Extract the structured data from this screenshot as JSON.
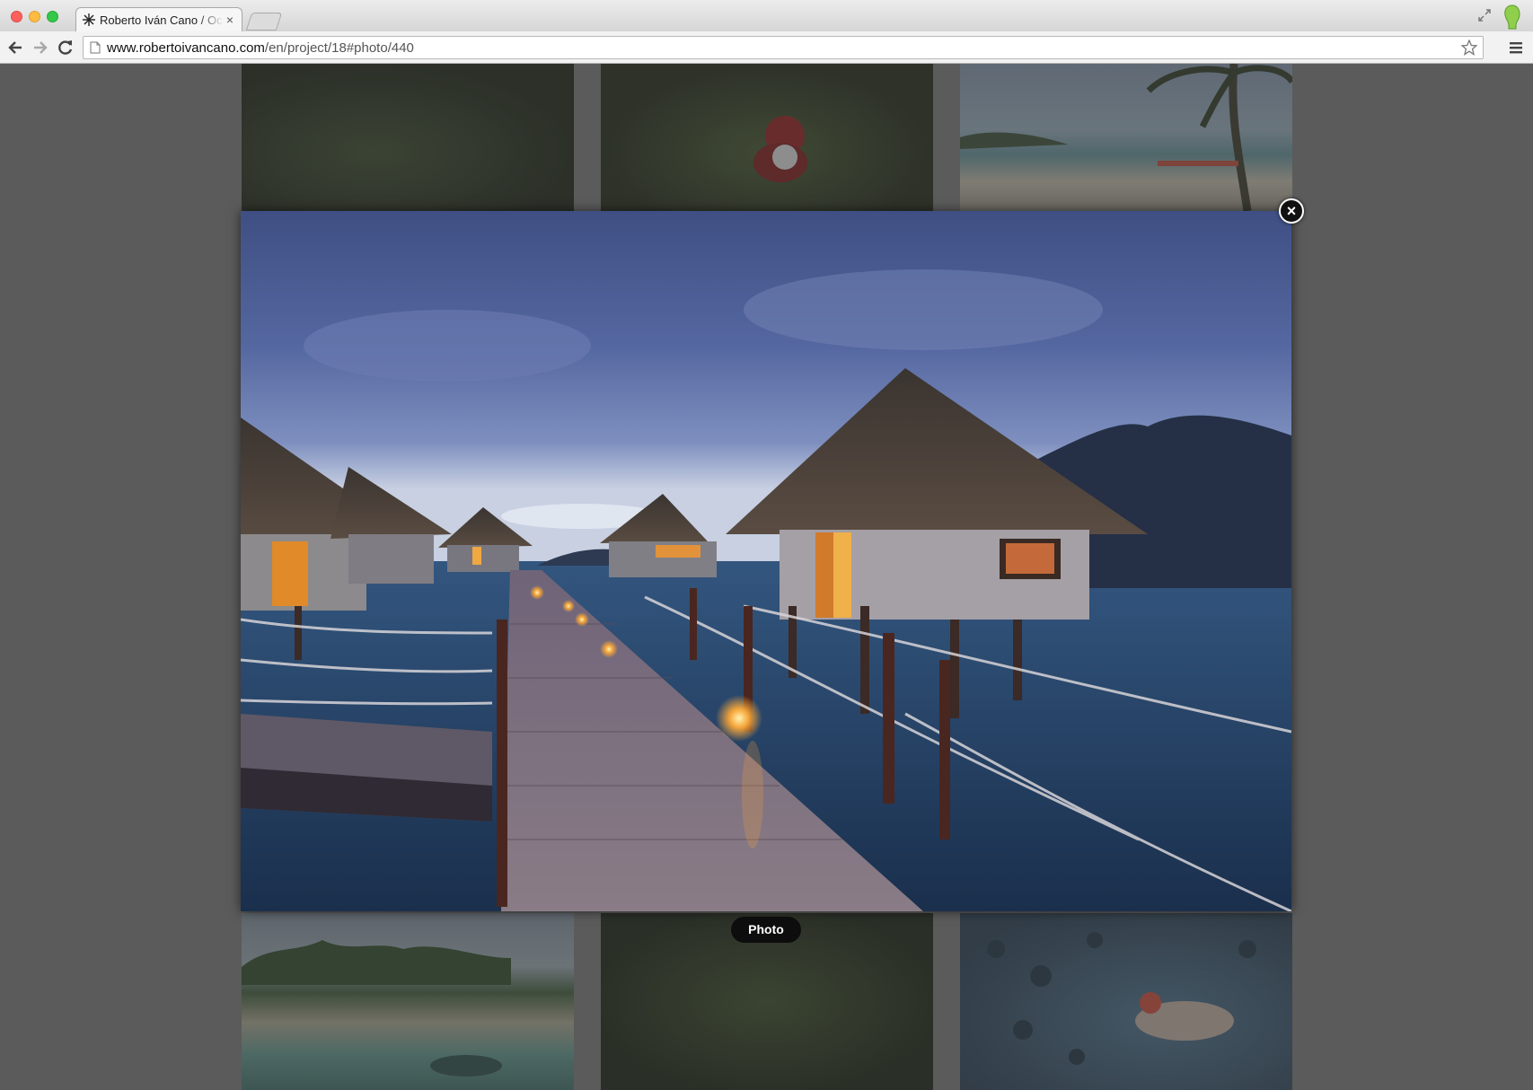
{
  "browser": {
    "tab_title": "Roberto Iván Cano / Ocean",
    "tab_close": "×",
    "url_domain": "www.robertoivancano.com",
    "url_path": "/en/project/18#photo/440"
  },
  "gallery": {
    "tiles_top": [
      {
        "name": "jungle-photo",
        "icon": "photo-thumbnail"
      },
      {
        "name": "climber-photo",
        "icon": "photo-thumbnail"
      },
      {
        "name": "beach-palm-photo",
        "icon": "photo-thumbnail"
      }
    ],
    "tiles_bottom": [
      {
        "name": "island-photo",
        "icon": "photo-thumbnail"
      },
      {
        "name": "fern-forest-photo",
        "icon": "photo-thumbnail"
      },
      {
        "name": "reef-snorkel-photo",
        "icon": "photo-thumbnail"
      }
    ]
  },
  "lightbox": {
    "close_label": "×",
    "caption": "Photo",
    "photo_subject": "overwater-bungalows-dusk"
  },
  "colors": {
    "overlay": "#5b5b5b",
    "caption_bg": "#0d0d0d",
    "close_bg": "#111111"
  }
}
